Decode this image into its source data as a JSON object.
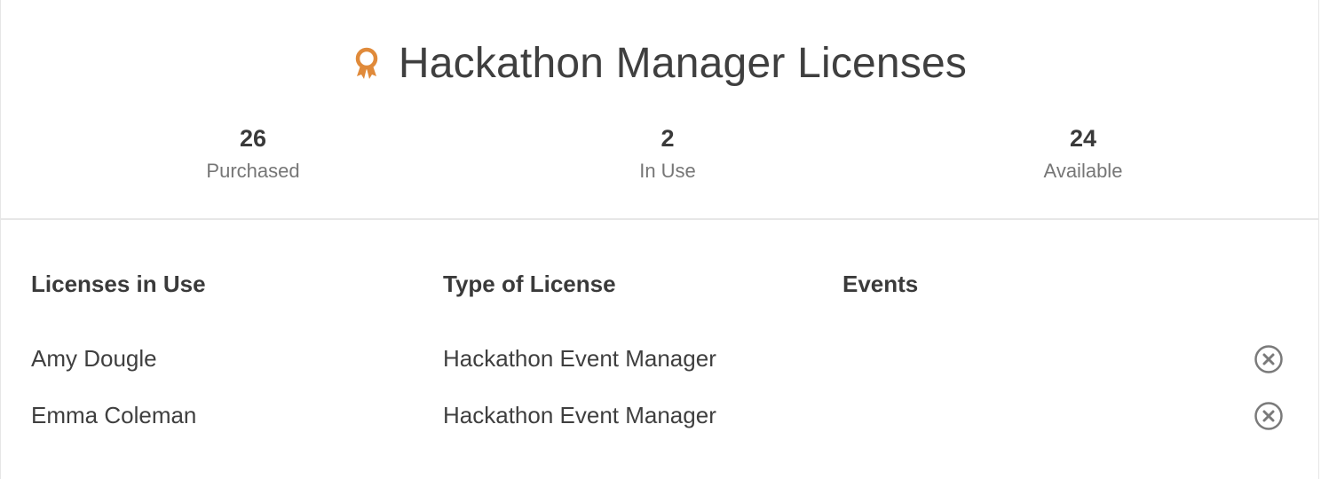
{
  "header": {
    "title": "Hackathon Manager Licenses",
    "icon": "award-ribbon-icon",
    "icon_color": "#e08a3a"
  },
  "stats": [
    {
      "value": "26",
      "label": "Purchased"
    },
    {
      "value": "2",
      "label": "In Use"
    },
    {
      "value": "24",
      "label": "Available"
    }
  ],
  "table": {
    "columns": [
      "Licenses in Use",
      "Type of License",
      "Events"
    ],
    "rows": [
      {
        "name": "Amy Dougle",
        "type": "Hackathon Event Manager",
        "events": "",
        "action_icon": "remove-circle-icon"
      },
      {
        "name": "Emma Coleman",
        "type": "Hackathon Event Manager",
        "events": "",
        "action_icon": "remove-circle-icon"
      }
    ]
  }
}
